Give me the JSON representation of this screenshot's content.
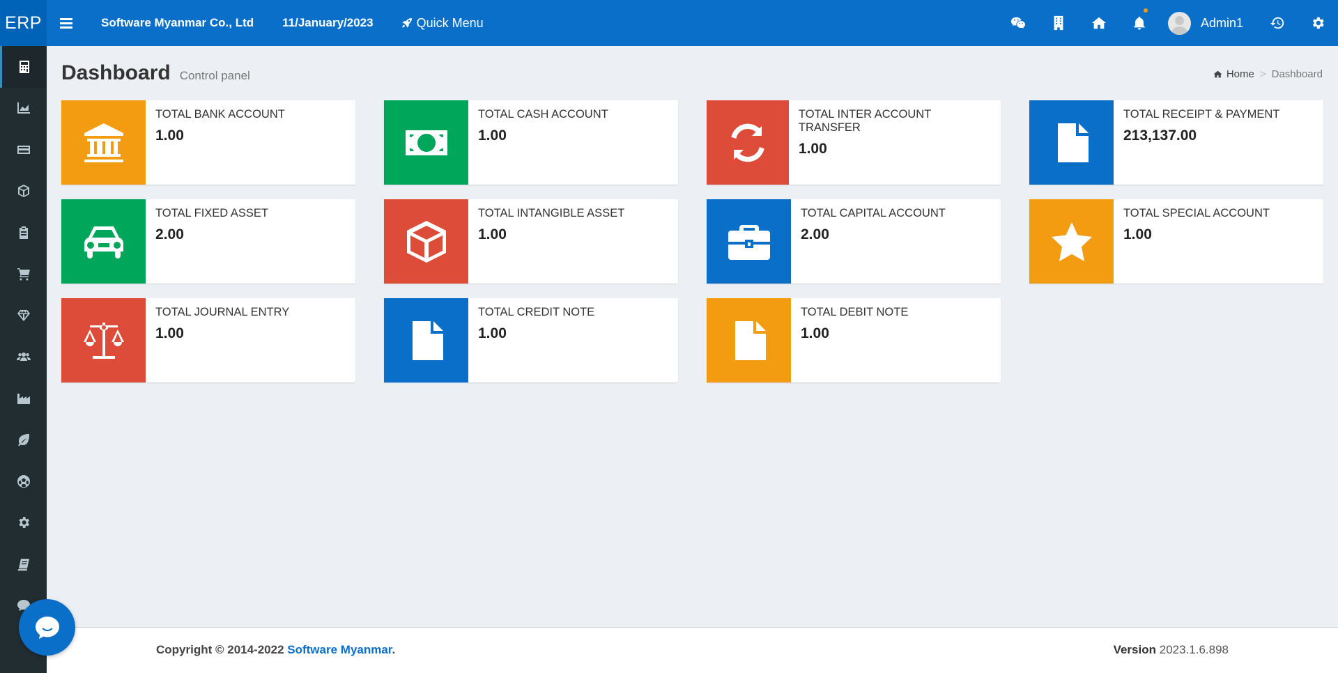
{
  "app": {
    "logo": "ERP",
    "company": "Software Myanmar Co., Ltd",
    "date": "11/January/2023",
    "quick_menu": "Quick Menu",
    "user_name": "Admin1"
  },
  "colors": {
    "header": "#0a6fc9",
    "sidebar": "#222d32",
    "orange": "#f39c12",
    "green": "#00a65a",
    "red": "#dd4b39",
    "blue": "#0a6fc9"
  },
  "header_icons": [
    "wechat-icon",
    "building-icon",
    "home-icon",
    "bell-icon",
    "history-icon",
    "gear-icon"
  ],
  "sidebar": {
    "items": [
      {
        "icon": "calculator-icon"
      },
      {
        "icon": "area-chart-icon"
      },
      {
        "icon": "credit-card-icon"
      },
      {
        "icon": "cube-icon"
      },
      {
        "icon": "clipboard-icon"
      },
      {
        "icon": "cart-icon"
      },
      {
        "icon": "diamond-icon"
      },
      {
        "icon": "users-icon"
      },
      {
        "icon": "industry-icon"
      },
      {
        "icon": "leaf-icon"
      },
      {
        "icon": "soccer-icon"
      },
      {
        "icon": "settings-icon"
      },
      {
        "icon": "book-icon"
      },
      {
        "icon": "comment-icon"
      }
    ]
  },
  "page": {
    "title": "Dashboard",
    "subtitle": "Control panel"
  },
  "breadcrumb": {
    "home": "Home",
    "separator": ">",
    "current": "Dashboard"
  },
  "cards": [
    {
      "label": "TOTAL BANK ACCOUNT",
      "value": "1.00",
      "color": "#f39c12",
      "icon": "bank-icon"
    },
    {
      "label": "TOTAL CASH ACCOUNT",
      "value": "1.00",
      "color": "#00a65a",
      "icon": "money-icon"
    },
    {
      "label": "TOTAL INTER ACCOUNT TRANSFER",
      "value": "1.00",
      "color": "#dd4b39",
      "icon": "refresh-icon"
    },
    {
      "label": "TOTAL RECEIPT & PAYMENT",
      "value": "213,137.00",
      "color": "#0a6fc9",
      "icon": "file-icon"
    },
    {
      "label": "TOTAL FIXED ASSET",
      "value": "2.00",
      "color": "#00a65a",
      "icon": "car-icon"
    },
    {
      "label": "TOTAL INTANGIBLE ASSET",
      "value": "1.00",
      "color": "#dd4b39",
      "icon": "cube-icon"
    },
    {
      "label": "TOTAL CAPITAL ACCOUNT",
      "value": "2.00",
      "color": "#0a6fc9",
      "icon": "briefcase-icon"
    },
    {
      "label": "TOTAL SPECIAL ACCOUNT",
      "value": "1.00",
      "color": "#f39c12",
      "icon": "star-icon"
    },
    {
      "label": "TOTAL JOURNAL ENTRY",
      "value": "1.00",
      "color": "#dd4b39",
      "icon": "balance-scale-icon"
    },
    {
      "label": "TOTAL CREDIT NOTE",
      "value": "1.00",
      "color": "#0a6fc9",
      "icon": "file-icon"
    },
    {
      "label": "TOTAL DEBIT NOTE",
      "value": "1.00",
      "color": "#f39c12",
      "icon": "file-icon"
    }
  ],
  "footer": {
    "copyright_prefix": "Copyright © 2014-2022 ",
    "brand": "Software Myanmar",
    "copyright_suffix": ".",
    "version_label": "Version",
    "version_value": "2023.1.6.898"
  }
}
